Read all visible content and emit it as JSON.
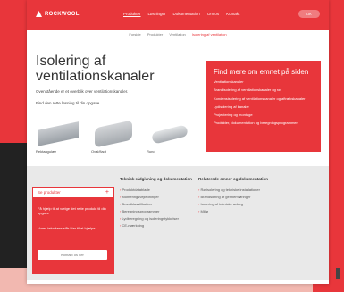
{
  "brand": {
    "name": "ROCKWOOL",
    "accent": "#e8363b"
  },
  "nav": {
    "items": [
      "Produkter",
      "Løsninger",
      "Dokumentation",
      "Om os",
      "Kontakt"
    ],
    "active_index": 0,
    "lang": "DK"
  },
  "breadcrumb": [
    "Forside",
    "Produkter",
    "Ventilation",
    "Isolering af ventilation"
  ],
  "page": {
    "title": "Isolering af ventilationskanaler",
    "intro": "Ovenstående er et overblik over ventilationskanaler.",
    "subtitle": "Find den rette løsning til din opgave"
  },
  "ducts": [
    {
      "label": "Rektangulær"
    },
    {
      "label": "Oval/fladt"
    },
    {
      "label": "Rund"
    }
  ],
  "panel": {
    "title": "Find mere om emnet på siden",
    "items": [
      "Ventilationskanaler",
      "Brandisolering af ventilationskanaler og rør",
      "Kondensisolering af ventilationskanaler og aftrækskanaler",
      "Lydisolering af kanaler",
      "Projektering og montage",
      "Produkter, dokumentation og beregningsprogrammer"
    ]
  },
  "sidebox": {
    "header": "Se produkter",
    "text1": "Få hjælp til at vælge det rette produkt til din opgave",
    "text2": "Vores teknikere står klar til at hjælpe",
    "button": "Kontakt os her"
  },
  "col1": {
    "title": "Teknisk rådgivning og dokumentation",
    "items": [
      "Produktdatablade",
      "Monteringsvejledninger",
      "Brandklassifikation",
      "Beregningsprogrammer",
      "Lydberegning og isoleringstykkelser",
      "CE-mærkning"
    ]
  },
  "col2": {
    "title": "Relaterede emner og dokumentation",
    "items": [
      "Rørisolering og tekniske installationer",
      "Brandsikring af gennemføringer",
      "Isolering af tekniske anlæg",
      "Miljø"
    ]
  }
}
